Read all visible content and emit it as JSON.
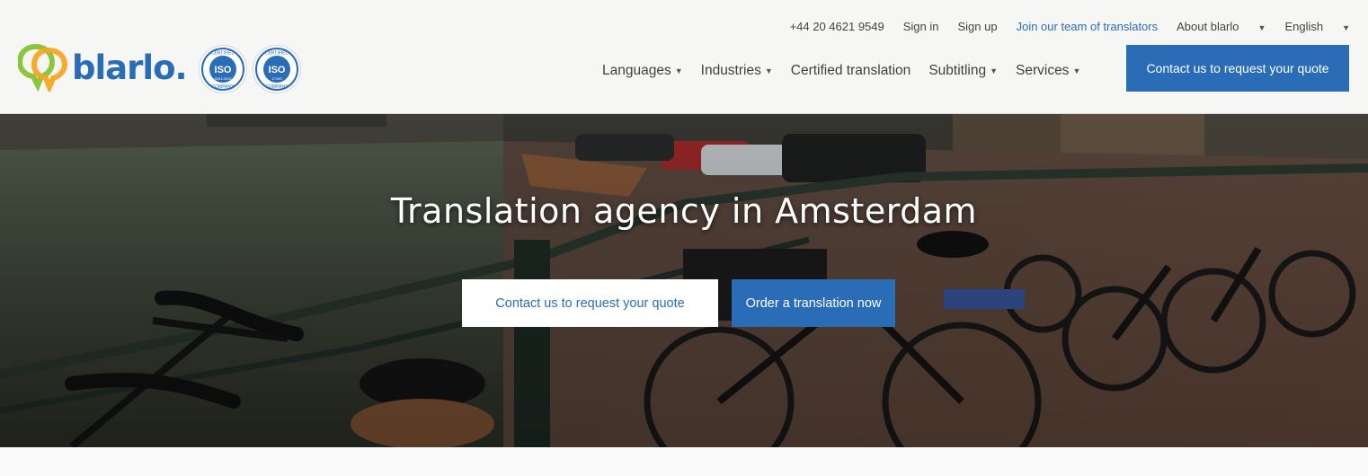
{
  "brand": {
    "name": "blarlo.",
    "logo_colors": [
      "#8cc63f",
      "#f5a623"
    ],
    "accent": "#2b6cb7"
  },
  "badges": [
    {
      "top": "CERTIFIED",
      "main": "ISO",
      "code": "9001:2015",
      "bottom": "COMPANY"
    },
    {
      "top": "CERTIFIED",
      "main": "ISO",
      "code": "17100",
      "bottom": "COMPANY"
    }
  ],
  "top_links": {
    "phone": "+44 20 4621 9549",
    "sign_in": "Sign in",
    "sign_up": "Sign up",
    "join": "Join our team of translators",
    "about": "About blarlo",
    "language": "English"
  },
  "nav": {
    "languages": "Languages",
    "industries": "Industries",
    "certified": "Certified translation",
    "subtitling": "Subtitling",
    "services": "Services",
    "cta": "Contact us to request your quote"
  },
  "hero": {
    "title": "Translation agency in Amsterdam",
    "btn_quote": "Contact us to request your quote",
    "btn_order": "Order a translation now"
  }
}
